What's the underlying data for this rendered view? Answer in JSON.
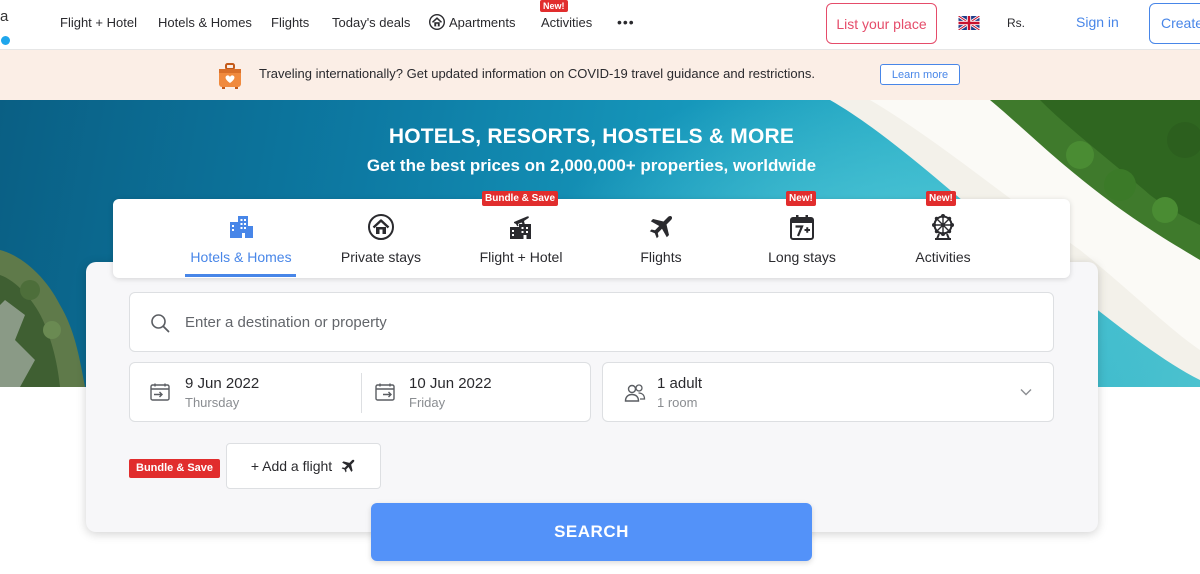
{
  "nav": {
    "items": [
      {
        "label": "Flight + Hotel"
      },
      {
        "label": "Hotels & Homes"
      },
      {
        "label": "Flights"
      },
      {
        "label": "Today's deals"
      },
      {
        "label": "Apartments"
      },
      {
        "label": "Activities",
        "badge": "New!"
      }
    ],
    "more_label": "•••",
    "list_place_label": "List your place",
    "language_icon": "uk-flag-icon",
    "currency_label": "Rs.",
    "sign_in_label": "Sign in",
    "create_account_label": "Create"
  },
  "banner": {
    "icon": "suitcase-heart-icon",
    "text": "Traveling internationally? Get updated information on COVID-19 travel guidance and restrictions.",
    "learn_more_label": "Learn more"
  },
  "hero": {
    "title": "HOTELS, RESORTS, HOSTELS & MORE",
    "subtitle": "Get the best prices on 2,000,000+ properties, worldwide"
  },
  "tabs": [
    {
      "label": "Hotels & Homes",
      "icon": "hotel-buildings-icon",
      "active": true
    },
    {
      "label": "Private stays",
      "icon": "private-home-icon"
    },
    {
      "label": "Flight + Hotel",
      "icon": "flight-hotel-icon",
      "badge": "Bundle & Save"
    },
    {
      "label": "Flights",
      "icon": "airplane-icon"
    },
    {
      "label": "Long stays",
      "icon": "calendar-7-plus-icon",
      "badge": "New!"
    },
    {
      "label": "Activities",
      "icon": "ferris-wheel-icon",
      "badge": "New!"
    }
  ],
  "search": {
    "destination_placeholder": "Enter a destination or property",
    "checkin": {
      "date": "9 Jun 2022",
      "day": "Thursday"
    },
    "checkout": {
      "date": "10 Jun 2022",
      "day": "Friday"
    },
    "guests": {
      "adults": "1 adult",
      "rooms": "1 room"
    },
    "bundle_label": "Bundle & Save",
    "add_flight_label": "+ Add a flight",
    "search_label": "SEARCH"
  },
  "colors": {
    "accent": "#5392f9",
    "link": "#4886e8",
    "list_place": "#e54c6a",
    "badge": "#e12d2d",
    "banner_bg": "#fbeee6"
  }
}
